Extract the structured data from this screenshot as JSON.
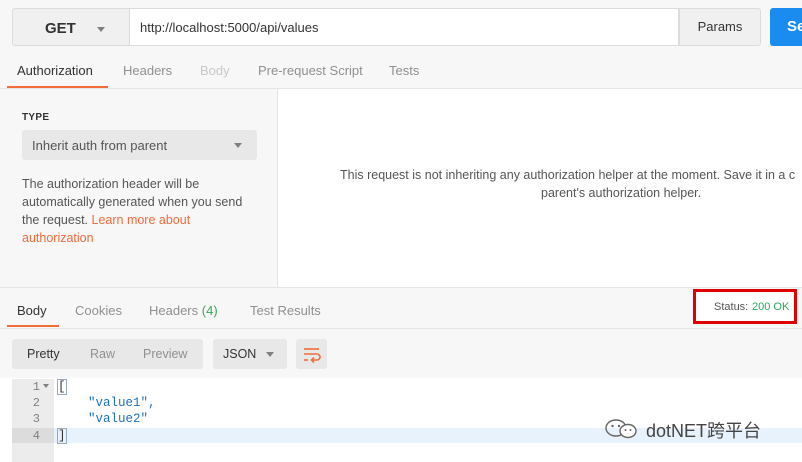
{
  "request": {
    "method": "GET",
    "url": "http://localhost:5000/api/values",
    "params_label": "Params",
    "send_label": "Se"
  },
  "request_tabs": [
    "Authorization",
    "Headers",
    "Body",
    "Pre-request Script",
    "Tests"
  ],
  "auth": {
    "type_label": "TYPE",
    "type_value": "Inherit auth from parent",
    "description": "The authorization header will be automatically generated when you send the request.",
    "link_text": "Learn more about authorization",
    "right_message_line1": "This request is not inheriting any authorization helper at the moment. Save it in a c",
    "right_message_line2": "parent's authorization helper."
  },
  "response_tabs": {
    "body": "Body",
    "cookies": "Cookies",
    "headers": "Headers",
    "headers_count": "(4)",
    "test_results": "Test Results"
  },
  "status": {
    "label": "Status:",
    "value": "200 OK"
  },
  "view": {
    "pretty": "Pretty",
    "raw": "Raw",
    "preview": "Preview",
    "format": "JSON"
  },
  "code": {
    "line_numbers": [
      "1",
      "2",
      "3",
      "4"
    ],
    "lines": [
      "[",
      "\"value1\",",
      "\"value2\"",
      "]"
    ]
  },
  "watermark": "dotNET跨平台",
  "colors": {
    "accent": "#f26b3a",
    "send": "#1a8cf0",
    "status_ok": "#25a85a",
    "highlight_box": "#e00000",
    "json_string": "#1f6fbf"
  },
  "icons": [
    "caret-down-icon",
    "wrap-lines-icon",
    "fold-arrow-icon",
    "wechat-icon"
  ]
}
